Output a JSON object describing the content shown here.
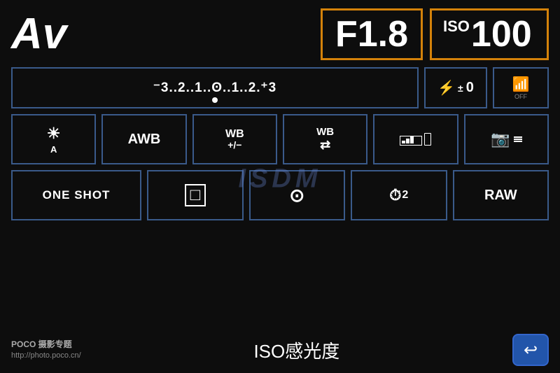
{
  "screen": {
    "mode": "Av",
    "aperture": "F1.8",
    "iso_label": "ISO",
    "iso_value": "100",
    "exposure_scale": "⁻3..2..1..0..1..2.⁺3",
    "exp_display": "-3..2..1..0..1..2.+3",
    "flash_label": "⚡±0",
    "wifi_label": "OFF",
    "metering_label": "⊙A",
    "awb_label": "AWB",
    "wb_plus_minus": "WB\n+/−",
    "wb_shift": "WB⇄",
    "display_label": "📊",
    "camera_settings": "📷",
    "one_shot": "ONE SHOT",
    "af_point": "□",
    "circle_af": "⊙",
    "timer_label": "⏱2",
    "raw_label": "RAW",
    "iso_footer": "ISO感光度",
    "back_arrow": "↩",
    "brand_name": "POCO 摄影专题",
    "brand_url": "http://photo.poco.cn/",
    "watermark": "ISDM"
  },
  "colors": {
    "border_orange": "#d4820a",
    "border_blue": "#3a5a8a",
    "back_btn_bg": "#2255aa",
    "text_white": "#ffffff",
    "text_grey": "#888888"
  }
}
